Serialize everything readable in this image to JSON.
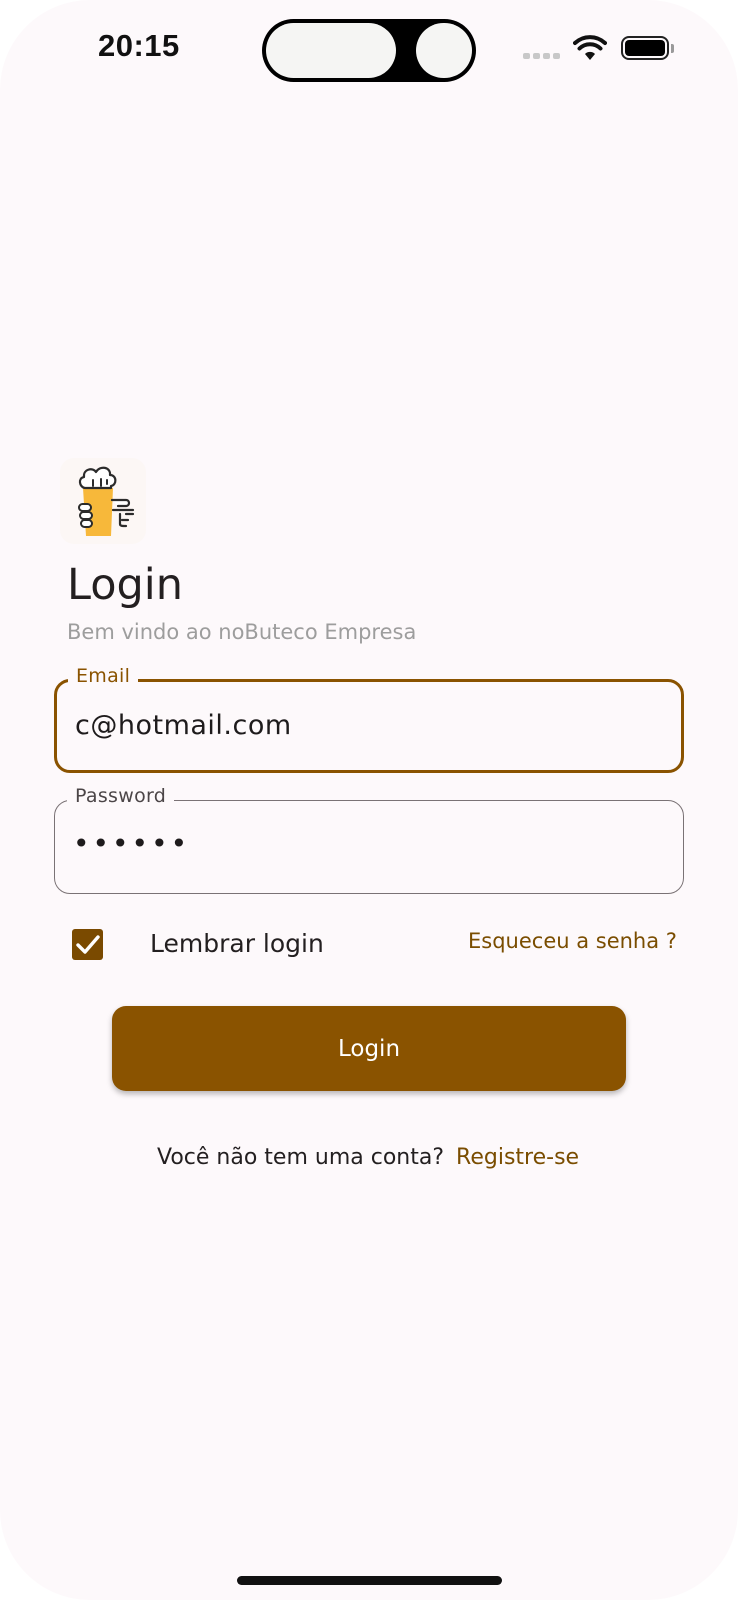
{
  "status_bar": {
    "time": "20:15",
    "icons": [
      "cellular-signal-icon",
      "wifi-icon",
      "battery-icon"
    ]
  },
  "logo": {
    "icon": "beer-mug-hand-icon"
  },
  "header": {
    "title": "Login",
    "subtitle": "Bem vindo ao noButeco Empresa"
  },
  "form": {
    "email": {
      "label": "Email",
      "value": "c@hotmail.com"
    },
    "password": {
      "label": "Password",
      "value": "••••••"
    },
    "remember": {
      "label": "Lembrar login",
      "checked": true
    },
    "forgot_link": "Esqueceu a senha ?",
    "submit_label": "Login"
  },
  "register": {
    "prompt": "Você não tem uma conta?",
    "link": "Registre-se"
  },
  "colors": {
    "primary": "#8a5300",
    "link": "#7a4d00",
    "background": "#fdf9fb",
    "subtitle": "#9d9d9d",
    "beer": "#f7b83a"
  }
}
